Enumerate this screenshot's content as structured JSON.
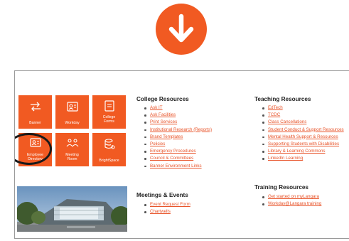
{
  "colors": {
    "accent": "#f15a22",
    "link": "#e8542a",
    "text": "#222222"
  },
  "arrow": {
    "icon": "arrow-down-icon"
  },
  "tiles": [
    {
      "label": "Banner",
      "icon": "arrow-right-left-icon"
    },
    {
      "label": "Workday",
      "icon": "id-card-icon"
    },
    {
      "label": "College Forms",
      "icon": "document-icon"
    },
    {
      "label": "Employee Directory",
      "icon": "contact-card-icon"
    },
    {
      "label": "Meeting Room",
      "icon": "people-icon"
    },
    {
      "label": "BrightSpace",
      "icon": "database-gear-icon"
    }
  ],
  "college_resources": {
    "title": "College Resources",
    "links": [
      "Ask IT",
      "Ask Facilities",
      "Print Services",
      "Institutional Research (Reports)",
      "Brand Templates",
      "Policies",
      "Emergency Procedures",
      "Council & Committees",
      "Banner Environment Links"
    ]
  },
  "meetings_events": {
    "title": "Meetings & Events",
    "links": [
      "Event Request Form",
      "Chartwells"
    ]
  },
  "teaching_resources": {
    "title": "Teaching Resources",
    "links": [
      "EdTech",
      "TCDC",
      "Class Cancellations",
      "Student Conduct & Support Resources",
      "Mental Health Support & Resources",
      "Supporting Students with Disabilities",
      "Library & Learning Commons",
      "LinkedIn Learning"
    ]
  },
  "training_resources": {
    "title": "Training Resources",
    "links": [
      "Get started on myLangara",
      "Workday@Langara training"
    ]
  }
}
